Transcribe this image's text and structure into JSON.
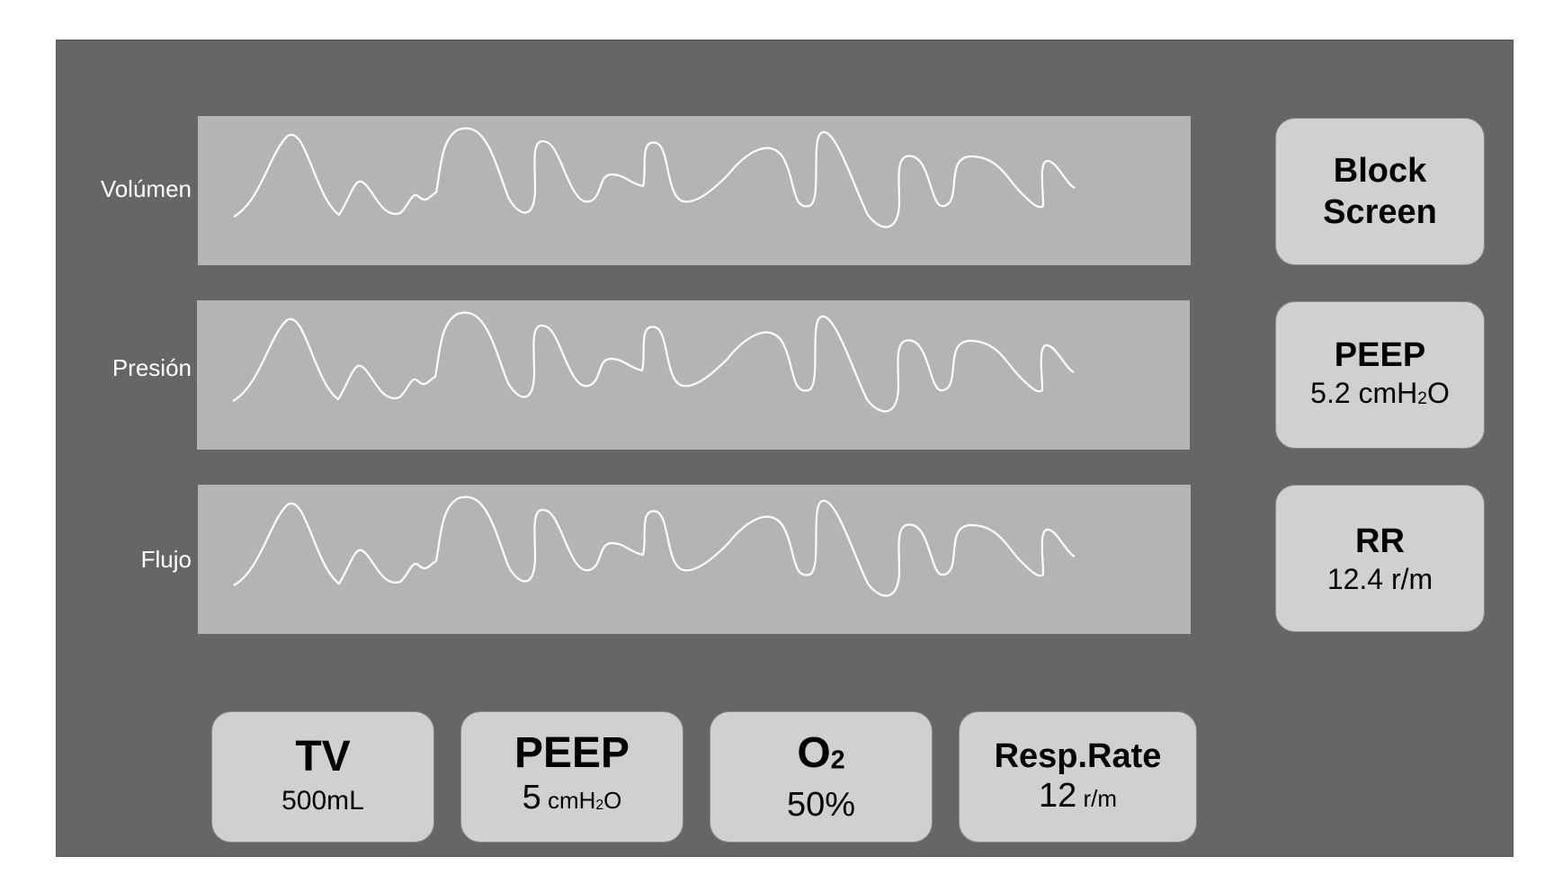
{
  "waveforms": [
    {
      "label": "Volúmen"
    },
    {
      "label": "Presión"
    },
    {
      "label": "Flujo"
    }
  ],
  "side_buttons": {
    "block": {
      "line1": "Block",
      "line2": "Screen"
    },
    "peep": {
      "title": "PEEP",
      "value": "5.2 cmH",
      "sub": "2",
      "suffix": "O"
    },
    "rr": {
      "title": "RR",
      "value": "12.4 r/m"
    }
  },
  "bottom_buttons": {
    "tv": {
      "title": "TV",
      "value": "500mL"
    },
    "peep": {
      "title": "PEEP",
      "value": "5",
      "unit": " cmH",
      "sub": "2",
      "suffix": "O"
    },
    "o2": {
      "title": "O",
      "sub": "2",
      "value": "50%"
    },
    "resp_rate": {
      "title": "Resp.Rate",
      "value": "12",
      "unit": " r/m"
    }
  },
  "colors": {
    "screen": "#666666",
    "panel": "#b4b4b4",
    "button": "#d0d0d0",
    "trace": "#ffffff"
  }
}
